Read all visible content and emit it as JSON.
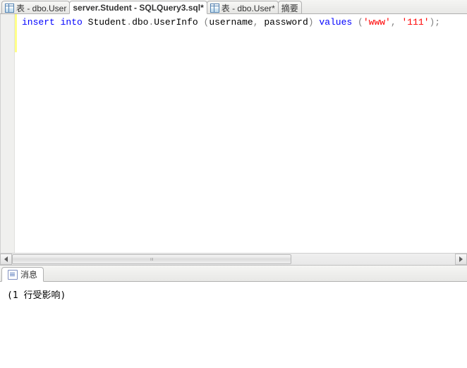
{
  "tabs": [
    {
      "label": "表 - dbo.User",
      "active": false,
      "hasIcon": true
    },
    {
      "label": "server.Student - SQLQuery3.sql*",
      "active": true,
      "hasIcon": false
    },
    {
      "label": "表 - dbo.User*",
      "active": false,
      "hasIcon": true
    },
    {
      "label": "摘要",
      "active": false,
      "hasIcon": false
    }
  ],
  "sql": {
    "tokens": [
      {
        "text": "insert",
        "cls": "kw-blue"
      },
      {
        "text": " ",
        "cls": ""
      },
      {
        "text": "into",
        "cls": "kw-blue"
      },
      {
        "text": " Student",
        "cls": "kw-black"
      },
      {
        "text": ".",
        "cls": "kw-gray"
      },
      {
        "text": "dbo",
        "cls": "kw-black"
      },
      {
        "text": ".",
        "cls": "kw-gray"
      },
      {
        "text": "UserInfo ",
        "cls": "kw-black"
      },
      {
        "text": "(",
        "cls": "kw-gray"
      },
      {
        "text": "username",
        "cls": "kw-black"
      },
      {
        "text": ",",
        "cls": "kw-gray"
      },
      {
        "text": " password",
        "cls": "kw-black"
      },
      {
        "text": ")",
        "cls": "kw-gray"
      },
      {
        "text": " ",
        "cls": ""
      },
      {
        "text": "values",
        "cls": "kw-blue"
      },
      {
        "text": " ",
        "cls": ""
      },
      {
        "text": "(",
        "cls": "kw-gray"
      },
      {
        "text": "'www'",
        "cls": "kw-red"
      },
      {
        "text": ",",
        "cls": "kw-gray"
      },
      {
        "text": " ",
        "cls": ""
      },
      {
        "text": "'111'",
        "cls": "kw-red"
      },
      {
        "text": ");",
        "cls": "kw-gray"
      }
    ]
  },
  "messages": {
    "tabLabel": "消息",
    "line1": "(1 行受影响)"
  }
}
